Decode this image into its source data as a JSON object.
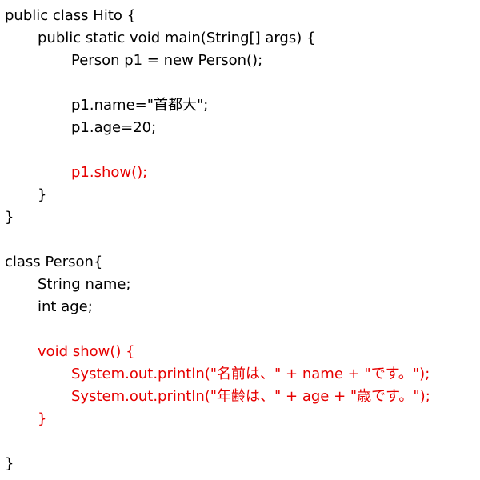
{
  "lines": [
    {
      "text": "public class Hito {",
      "indent": 0,
      "color": "black"
    },
    {
      "text": "public static void main(String[] args) {",
      "indent": 1,
      "color": "black"
    },
    {
      "text": "Person p1 = new Person();",
      "indent": 2,
      "color": "black"
    },
    {
      "text": "",
      "indent": 0,
      "color": "black"
    },
    {
      "text": "p1.name=\"首都大\";",
      "indent": 2,
      "color": "black"
    },
    {
      "text": "p1.age=20;",
      "indent": 2,
      "color": "black"
    },
    {
      "text": "",
      "indent": 0,
      "color": "black"
    },
    {
      "text": "p1.show();",
      "indent": 2,
      "color": "red"
    },
    {
      "text": "}",
      "indent": 1,
      "color": "black"
    },
    {
      "text": "}",
      "indent": 0,
      "color": "black"
    },
    {
      "text": "",
      "indent": 0,
      "color": "black"
    },
    {
      "text": "class Person{",
      "indent": 0,
      "color": "black"
    },
    {
      "text": "String name;",
      "indent": 1,
      "color": "black"
    },
    {
      "text": "int age;",
      "indent": 1,
      "color": "black"
    },
    {
      "text": "",
      "indent": 0,
      "color": "black"
    },
    {
      "text": "void show() {",
      "indent": 1,
      "color": "red"
    },
    {
      "text": "System.out.println(\"名前は、\" + name + \"です。\");",
      "indent": 2,
      "color": "red"
    },
    {
      "text": "System.out.println(\"年齢は、\" + age + \"歳です。\");",
      "indent": 2,
      "color": "red"
    },
    {
      "text": "}",
      "indent": 1,
      "color": "red"
    },
    {
      "text": "",
      "indent": 0,
      "color": "black"
    },
    {
      "text": "}",
      "indent": 0,
      "color": "black"
    }
  ],
  "colors": {
    "text": "#000000",
    "highlight": "#e60000",
    "background": "#ffffff"
  }
}
